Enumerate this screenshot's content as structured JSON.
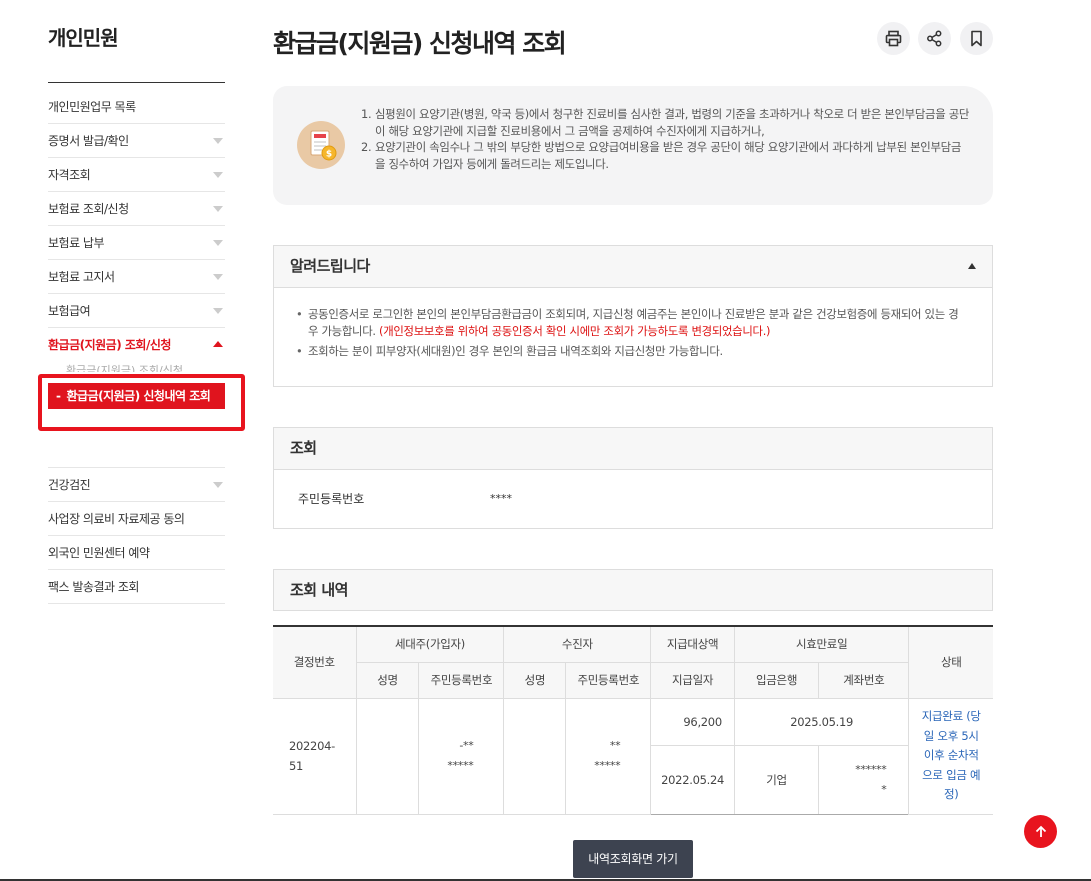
{
  "sidebar": {
    "title": "개인민원",
    "items": [
      {
        "label": "개인민원업무 목록"
      },
      {
        "label": "증명서 발급/확인"
      },
      {
        "label": "자격조회"
      },
      {
        "label": "보험료 조회/신청"
      },
      {
        "label": "보험료 납부"
      },
      {
        "label": "보험료 고지서"
      },
      {
        "label": "보험급여"
      },
      {
        "label": "환급금(지원금) 조회/신청"
      },
      {
        "label": "건강검진"
      },
      {
        "label": "사업장 의료비 자료제공 동의"
      },
      {
        "label": "외국인 민원센터 예약"
      },
      {
        "label": "팩스 발송결과 조회"
      }
    ],
    "sub_items": {
      "ghost": "환급금(지원금) 조회/신청",
      "active": "환급금(지원금) 신청내역 조회",
      "dash": "-"
    }
  },
  "page": {
    "title": "환급금(지원금) 신청내역 조회"
  },
  "header_icons": [
    "print-icon",
    "share-icon",
    "bookmark-icon"
  ],
  "intro": {
    "items": [
      {
        "num": "1.",
        "text": "심평원이 요양기관(병원, 약국 등)에서 청구한 진료비를 심사한 결과, 법령의 기준을 초과하거나 착오로 더 받은 본인부담금을 공단이 해당 요양기관에 지급할 진료비용에서 그 금액을 공제하여 수진자에게 지급하거나,"
      },
      {
        "num": "2.",
        "text": "요양기관이 속임수나 그 밖의 부당한 방법으로 요양급여비용을 받은 경우 공단이 해당 요양기관에서 과다하게 납부된 본인부담금을 징수하여 가입자 등에게 돌려드리는 제도입니다."
      }
    ]
  },
  "notice": {
    "title": "알려드립니다",
    "item1_text": "공동인증서로 로그인한 본인의 본인부담금환급금이 조회되며, 지급신청 예금주는 본인이나 진료받은 분과 같은 건강보험증에 등재되어 있는 경우 가능합니다.",
    "item1_red": "(개인정보보호를 위하여 공동인증서 확인 시에만 조회가 가능하도록 변경되었습니다.)",
    "item2_text": "조회하는 분이 피부양자(세대원)인 경우 본인의 환급금 내역조회와 지급신청만 가능합니다."
  },
  "query": {
    "title": "조회",
    "label": "주민등록번호",
    "value": "****"
  },
  "results": {
    "title": "조회 내역",
    "headers": {
      "decision_no": "결정번호",
      "householder": "세대주(가입자)",
      "patient": "수진자",
      "pay_amount": "지급대상액",
      "expiry": "시효만료일",
      "status": "상태",
      "name": "성명",
      "rrn": "주민등록번호",
      "pay_date": "지급일자",
      "bank": "입금은행",
      "account": "계좌번호"
    },
    "row": {
      "decision_no": "202204-51",
      "hh_name": "",
      "hh_rrn": "-** *****",
      "pt_name": "",
      "pt_rrn": "** *****",
      "amount": "96,200",
      "expiry": "2025.05.19",
      "pay_date": "2022.05.24",
      "bank": "기업",
      "account": "****** *",
      "status": "지급완료 (당일 오후 5시 이후 순차적으로 입금 예정)"
    }
  },
  "buttons": {
    "goto_list": "내역조회화면 가기"
  },
  "colors": {
    "accent": "#e0141e",
    "link": "#2a66b8",
    "button_dark": "#3d4350"
  }
}
